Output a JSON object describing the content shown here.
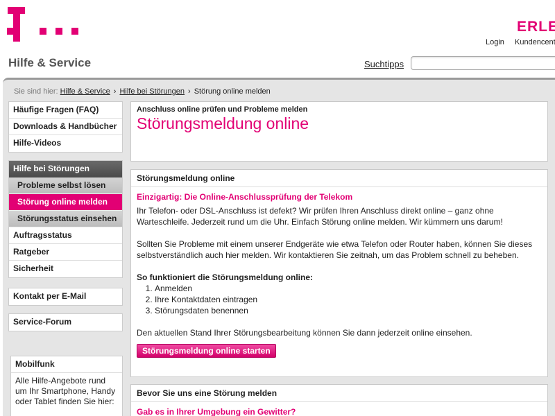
{
  "header": {
    "logo": "T · · ·",
    "slogan": "ERLEB",
    "links": [
      "Login",
      "Kundencenter"
    ],
    "brand": "Hilfe & Service",
    "search_link": "Suchtipps",
    "search_placeholder": ""
  },
  "breadcrumb": {
    "prefix": "Sie sind hier:",
    "items": [
      "Hilfe & Service",
      "Hilfe bei Störungen"
    ],
    "current": "Störung online melden"
  },
  "sidebar": {
    "group1": [
      "Häufige Fragen (FAQ)",
      "Downloads & Handbücher",
      "Hilfe-Videos"
    ],
    "group2_head": "Hilfe bei Störungen",
    "group2_subs": [
      "Probleme selbst lösen",
      "Störung online melden",
      "Störungsstatus einsehen"
    ],
    "group2_items": [
      "Auftragsstatus",
      "Ratgeber",
      "Sicherheit"
    ],
    "contact": "Kontakt per E-Mail",
    "forum": "Service-Forum",
    "mobilfunk_title": "Mobilfunk",
    "mobilfunk_text": "Alle Hilfe-Angebote rund um Ihr Smartphone, Handy oder Tablet finden Sie hier:"
  },
  "content": {
    "top_small": "Anschluss online prüfen und Probleme melden",
    "top_title": "Störungsmeldung online",
    "panel2_head": "Störungsmeldung online",
    "highlight": "Einzigartig: Die Online-Anschlussprüfung der Telekom",
    "para1": "Ihr Telefon- oder DSL-Anschluss ist defekt? Wir prüfen Ihren Anschluss direkt online – ganz ohne Warteschleife. Jederzeit rund um die Uhr. Einfach Störung online melden. Wir kümmern uns darum!",
    "para2": "Sollten Sie Probleme mit einem unserer Endgeräte wie etwa Telefon oder Router haben, können Sie dieses selbstverständlich auch hier melden. Wir kontaktieren Sie zeitnah, um das Problem schnell zu beheben.",
    "steps_title": "So funktioniert die Störungsmeldung online:",
    "steps": [
      "Anmelden",
      "Ihre Kontaktdaten eintragen",
      "Störungsdaten benennen"
    ],
    "para3": "Den aktuellen Stand Ihrer Störungsbearbeitung können Sie dann jederzeit online einsehen.",
    "button": "Störungsmeldung online starten",
    "panel3_head": "Bevor Sie uns eine Störung melden",
    "panel3_sub": "Gab es in Ihrer Umgebung ein Gewitter?"
  },
  "colors": {
    "brand": "#e20074"
  }
}
